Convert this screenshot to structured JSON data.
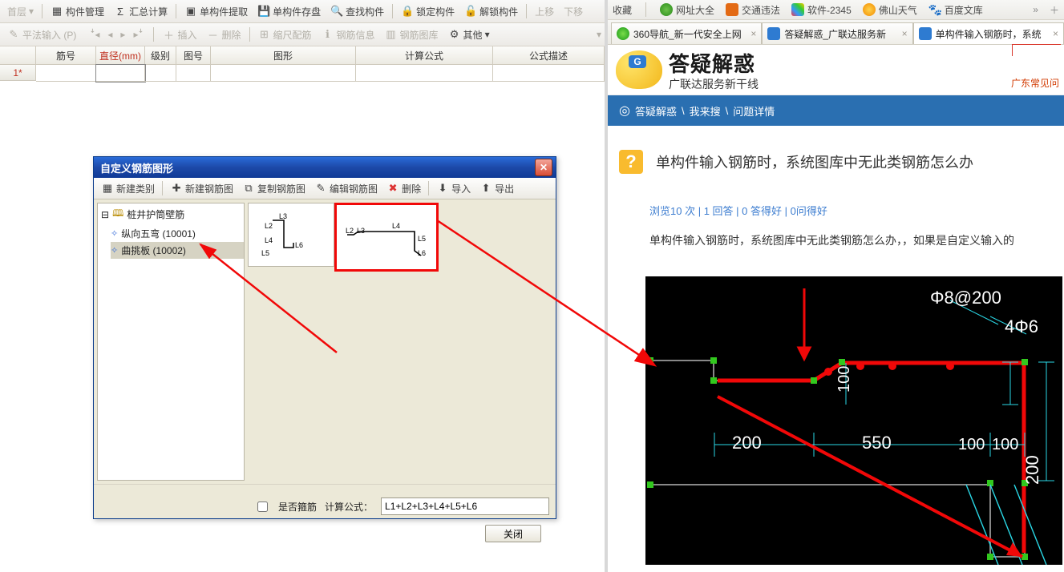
{
  "toolbar1": {
    "btn_layer": "首层",
    "btn_mgr": "构件管理",
    "btn_sum": "汇总计算",
    "btn_extract": "单构件提取",
    "btn_save": "单构件存盘",
    "btn_find": "查找构件",
    "btn_lock": "锁定构件",
    "btn_unlock": "解锁构件",
    "btn_up": "上移",
    "btn_down": "下移"
  },
  "toolbar2": {
    "btn_input": "平法输入 (P)",
    "btn_insert": "插入",
    "btn_delete": "删除",
    "btn_scale": "缩尺配筋",
    "btn_info": "钢筋信息",
    "btn_lib": "钢筋图库",
    "btn_other": "其他"
  },
  "grid": {
    "h_no": "筋号",
    "h_dia": "直径(mm)",
    "h_level": "级别",
    "h_fig": "图号",
    "h_shape": "图形",
    "h_formula": "计算公式",
    "h_desc": "公式描述",
    "row_label": "1*"
  },
  "dialog": {
    "title": "自定义钢筋图形",
    "btn_newcat": "新建类别",
    "btn_newfig": "新建钢筋图",
    "btn_copyfig": "复制钢筋图",
    "btn_editfig": "编辑钢筋图",
    "btn_del": "删除",
    "btn_import": "导入",
    "btn_export": "导出",
    "tree_root": "桩井护筒壁筋",
    "tree_item1": "纵向五弯 (10001)",
    "tree_item2": "曲挑板 (10002)",
    "shape1_labels": "L3 L2 L4 L5 L6",
    "shape2_labels": "L2 L3   L4   L5 L6",
    "chk_label": "是否箍筋",
    "formula_label": "计算公式：",
    "formula_value": "L1+L2+L3+L4+L5+L6",
    "btn_close": "关闭"
  },
  "bookmarks": {
    "b0": "收藏",
    "b1": "网址大全",
    "b2": "交通违法",
    "b3": "软件-2345",
    "b4": "佛山天气",
    "b5": "百度文库"
  },
  "tabs": {
    "t1": "360导航_新一代安全上网",
    "t2": "答疑解惑_广联达服务新",
    "t3": "单构件输入钢筋时，系统"
  },
  "brand": {
    "line1": "答疑解惑",
    "line2": "广联达服务新干线",
    "hot": "广东常见问"
  },
  "bluebar": {
    "crumb1": "答疑解惑",
    "crumb2": "我来搜",
    "crumb3": "问题详情"
  },
  "question": {
    "badge": "?",
    "title": "单构件输入钢筋时，系统图库中无此类钢筋怎么办",
    "stats1": "浏览10 次",
    "stats2": "1 回答",
    "stats3": "0 答得好",
    "stats4": "0问得好",
    "desc": "单构件输入钢筋时，系统图库中无此类钢筋怎么办，，如果是自定义输入的"
  },
  "cad": {
    "t1": "Φ8@200",
    "t2": "4Φ6",
    "d200": "200",
    "d550": "550",
    "d100": "100",
    "d100b": "100",
    "d200v": "200",
    "d100v": "100"
  }
}
